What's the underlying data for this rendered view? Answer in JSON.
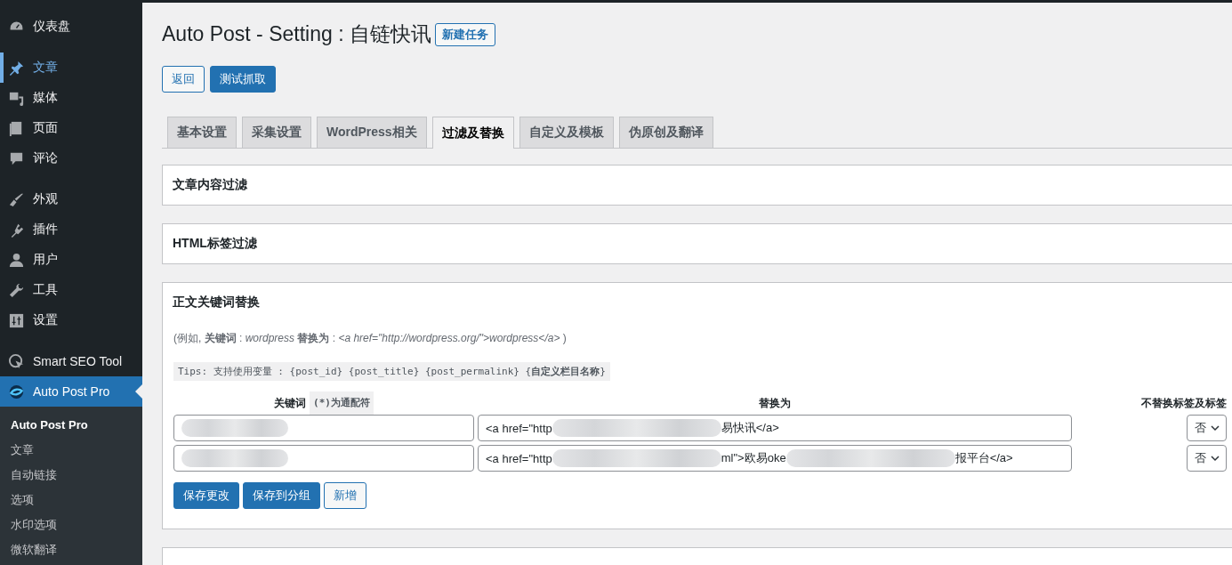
{
  "sidebar": {
    "groups": [
      [
        {
          "label": "仪表盘",
          "highlighted": false,
          "selected": false
        }
      ],
      [
        {
          "label": "文章",
          "highlighted": true,
          "selected": false
        },
        {
          "label": "媒体",
          "highlighted": false,
          "selected": false
        },
        {
          "label": "页面",
          "highlighted": false,
          "selected": false
        },
        {
          "label": "评论",
          "highlighted": false,
          "selected": false
        }
      ],
      [
        {
          "label": "外观",
          "highlighted": false,
          "selected": false
        },
        {
          "label": "插件",
          "highlighted": false,
          "selected": false
        },
        {
          "label": "用户",
          "highlighted": false,
          "selected": false
        },
        {
          "label": "工具",
          "highlighted": false,
          "selected": false
        },
        {
          "label": "设置",
          "highlighted": false,
          "selected": false
        }
      ],
      [
        {
          "label": "Smart SEO Tool",
          "highlighted": false,
          "selected": false
        },
        {
          "label": "Auto Post Pro",
          "highlighted": false,
          "selected": true
        }
      ]
    ],
    "submenu": [
      {
        "label": "Auto Post Pro",
        "selected": true
      },
      {
        "label": "文章",
        "selected": false
      },
      {
        "label": "自动链接",
        "selected": false
      },
      {
        "label": "选项",
        "selected": false
      },
      {
        "label": "水印选项",
        "selected": false
      },
      {
        "label": "微软翻译",
        "selected": false
      }
    ]
  },
  "page": {
    "title": "Auto Post - Setting : 自链快讯",
    "title_button": "新建任务",
    "buttons": [
      {
        "label": "返回",
        "kind": "secondary"
      },
      {
        "label": "测试抓取",
        "kind": "primary"
      }
    ],
    "tabs": [
      {
        "label": "基本设置",
        "selected": false
      },
      {
        "label": "采集设置",
        "selected": false
      },
      {
        "label": "WordPress相关",
        "selected": false
      },
      {
        "label": "过滤及替换",
        "selected": true
      },
      {
        "label": "自定义及模板",
        "selected": false
      },
      {
        "label": "伪原创及翻译",
        "selected": false
      }
    ],
    "panels": [
      {
        "title": "文章内容过滤",
        "kind": "collapsed"
      },
      {
        "title": "HTML标签过滤",
        "kind": "collapsed"
      },
      {
        "title": "正文关键词替换",
        "kind": "replace",
        "example": "(例如, **关键词** : *wordpress*   **替换为** : *<a href=\"http://wordpress.org/\">wordpress</a>* )",
        "tips": "Tips: 支持使用变量 : {post_id} {post_title} {post_permalink} {**自定义栏目名称**}",
        "columns": [
          {
            "label": "关键词",
            "note": "(*)为通配符"
          },
          {
            "label": "替换为"
          },
          {
            "label": "不替换标签及标签"
          }
        ],
        "rows": [
          {
            "keyword": [
              {
                "kind": "blur"
              }
            ],
            "replacement": [
              {
                "kind": "text",
                "text": "<a href=\"http"
              },
              {
                "kind": "blur"
              },
              {
                "kind": "text",
                "text": "易快讯</a>"
              }
            ],
            "option": "否"
          },
          {
            "keyword": [
              {
                "kind": "blur"
              }
            ],
            "replacement": [
              {
                "kind": "text",
                "text": "<a href=\"http"
              },
              {
                "kind": "blur"
              },
              {
                "kind": "text",
                "text": "ml\">欧易oke"
              },
              {
                "kind": "blur"
              },
              {
                "kind": "text",
                "text": "报平台</a>"
              }
            ],
            "option": "否"
          }
        ],
        "actions": [
          {
            "label": "保存更改",
            "kind": "primary"
          },
          {
            "label": "保存到分组",
            "kind": "primary"
          },
          {
            "label": "新增",
            "kind": "secondary"
          }
        ]
      },
      {
        "kind": "cut"
      }
    ]
  }
}
